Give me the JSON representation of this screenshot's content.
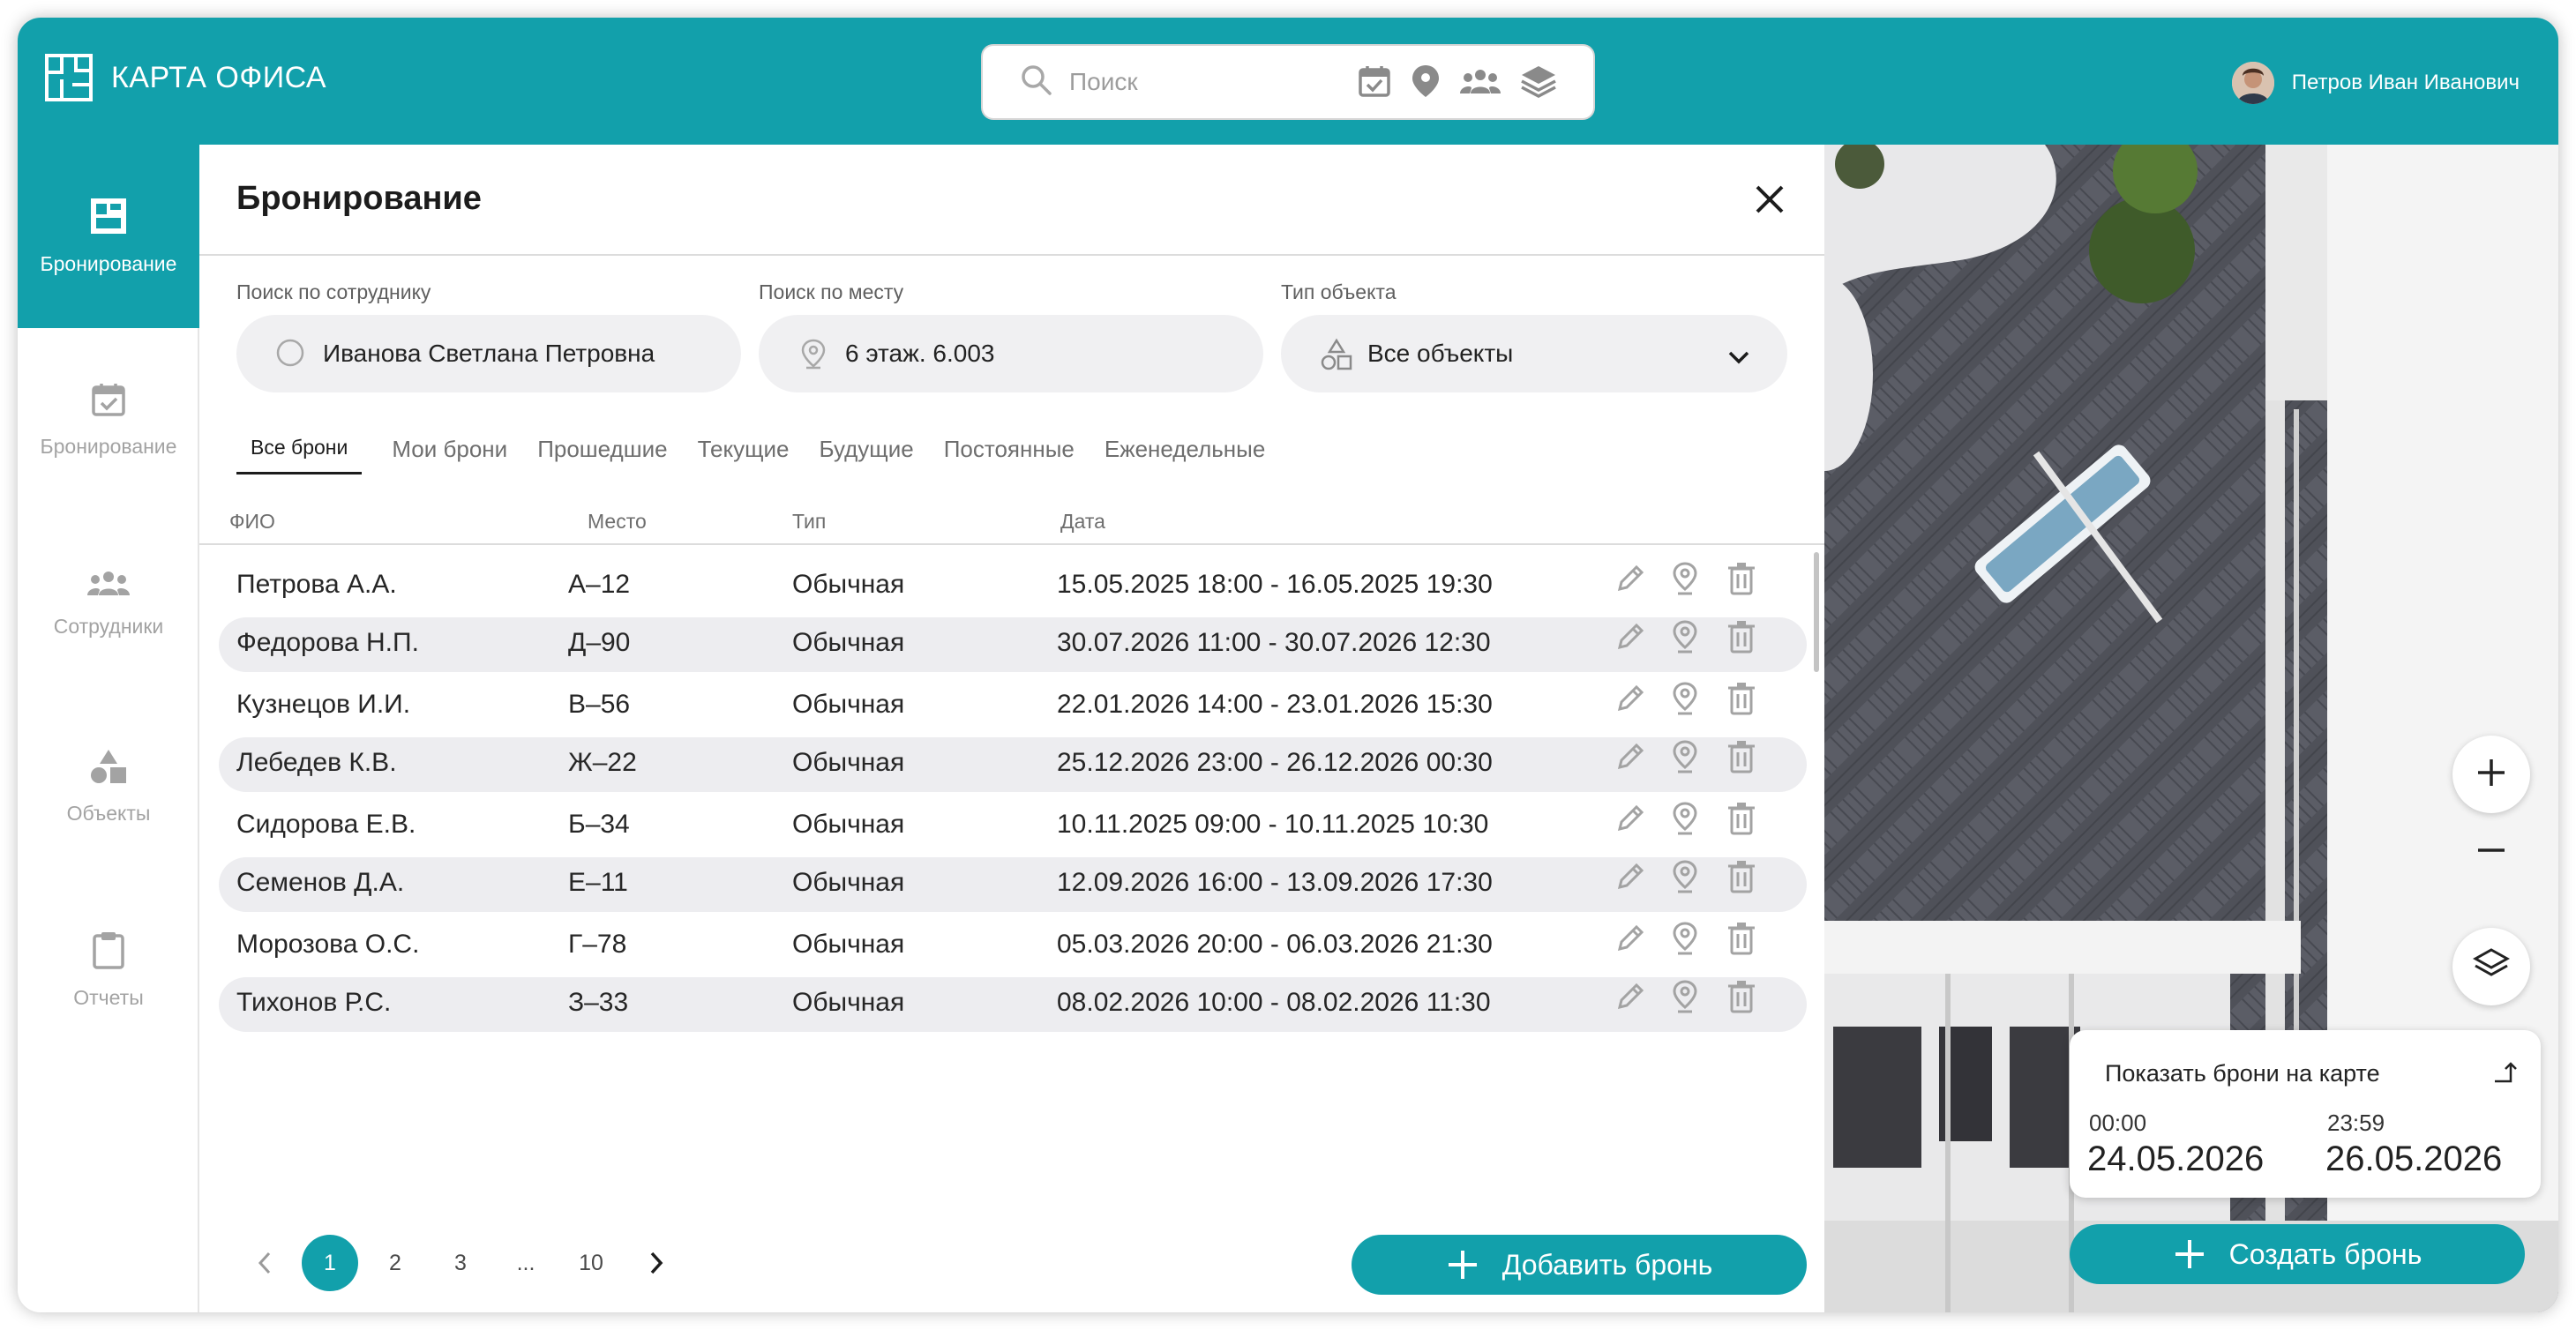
{
  "header": {
    "app_title": "КАРТА ОФИСА",
    "search_placeholder": "Поиск",
    "user_name": "Петров Иван Иванович"
  },
  "sidebar": {
    "items": [
      {
        "label": "Бронирование",
        "icon": "floorplan-icon",
        "active": true
      },
      {
        "label": "Бронирование",
        "icon": "calendar-check-icon",
        "active": false
      },
      {
        "label": "Сотрудники",
        "icon": "people-icon",
        "active": false
      },
      {
        "label": "Объекты",
        "icon": "shapes-icon",
        "active": false
      },
      {
        "label": "Отчеты",
        "icon": "clipboard-icon",
        "active": false
      }
    ]
  },
  "panel": {
    "title": "Бронирование",
    "filters": {
      "employee": {
        "label": "Поиск по сотруднику",
        "value": "Иванова Светлана Петровна"
      },
      "place": {
        "label": "Поиск по месту",
        "value": "6 этаж. 6.003"
      },
      "type": {
        "label": "Тип объекта",
        "value": "Все объекты"
      }
    },
    "tabs": [
      "Все брони",
      "Мои брони",
      "Прошедшие",
      "Текущие",
      "Будущие",
      "Постоянные",
      "Еженедельные"
    ],
    "active_tab": "Все брони",
    "columns": {
      "name": "ФИО",
      "place": "Место",
      "type": "Тип",
      "date": "Дата"
    },
    "rows": [
      {
        "name": "Петрова А.А.",
        "place": "А–12",
        "type": "Обычная",
        "date": "15.05.2025 18:00 - 16.05.2025 19:30"
      },
      {
        "name": "Федорова Н.П.",
        "place": "Д–90",
        "type": "Обычная",
        "date": "30.07.2026 11:00 - 30.07.2026 12:30"
      },
      {
        "name": "Кузнецов И.И.",
        "place": "В–56",
        "type": "Обычная",
        "date": "22.01.2026 14:00 - 23.01.2026 15:30"
      },
      {
        "name": "Лебедев К.В.",
        "place": "Ж–22",
        "type": "Обычная",
        "date": "25.12.2026 23:00 - 26.12.2026 00:30"
      },
      {
        "name": "Сидорова Е.В.",
        "place": "Б–34",
        "type": "Обычная",
        "date": "10.11.2025 09:00 - 10.11.2025 10:30"
      },
      {
        "name": "Семенов Д.А.",
        "place": "Е–11",
        "type": "Обычная",
        "date": "12.09.2026 16:00 - 13.09.2026 17:30"
      },
      {
        "name": "Морозова О.С.",
        "place": "Г–78",
        "type": "Обычная",
        "date": "05.03.2026 20:00 - 06.03.2026 21:30"
      },
      {
        "name": "Тихонов Р.С.",
        "place": "З–33",
        "type": "Обычная",
        "date": "08.02.2026 10:00 - 08.02.2026 11:30"
      }
    ],
    "pagination": {
      "pages": [
        "1",
        "2",
        "3",
        "...",
        "10"
      ],
      "current": "1"
    },
    "add_button": "Добавить бронь"
  },
  "map": {
    "card_title": "Показать брони на карте",
    "from_time": "00:00",
    "from_date": "24.05.2026",
    "to_time": "23:59",
    "to_date": "26.05.2026",
    "create_button": "Создать бронь"
  },
  "colors": {
    "accent": "#12a0ab",
    "row_alt": "#ededf0",
    "icon_gray": "#a3a3a3"
  }
}
